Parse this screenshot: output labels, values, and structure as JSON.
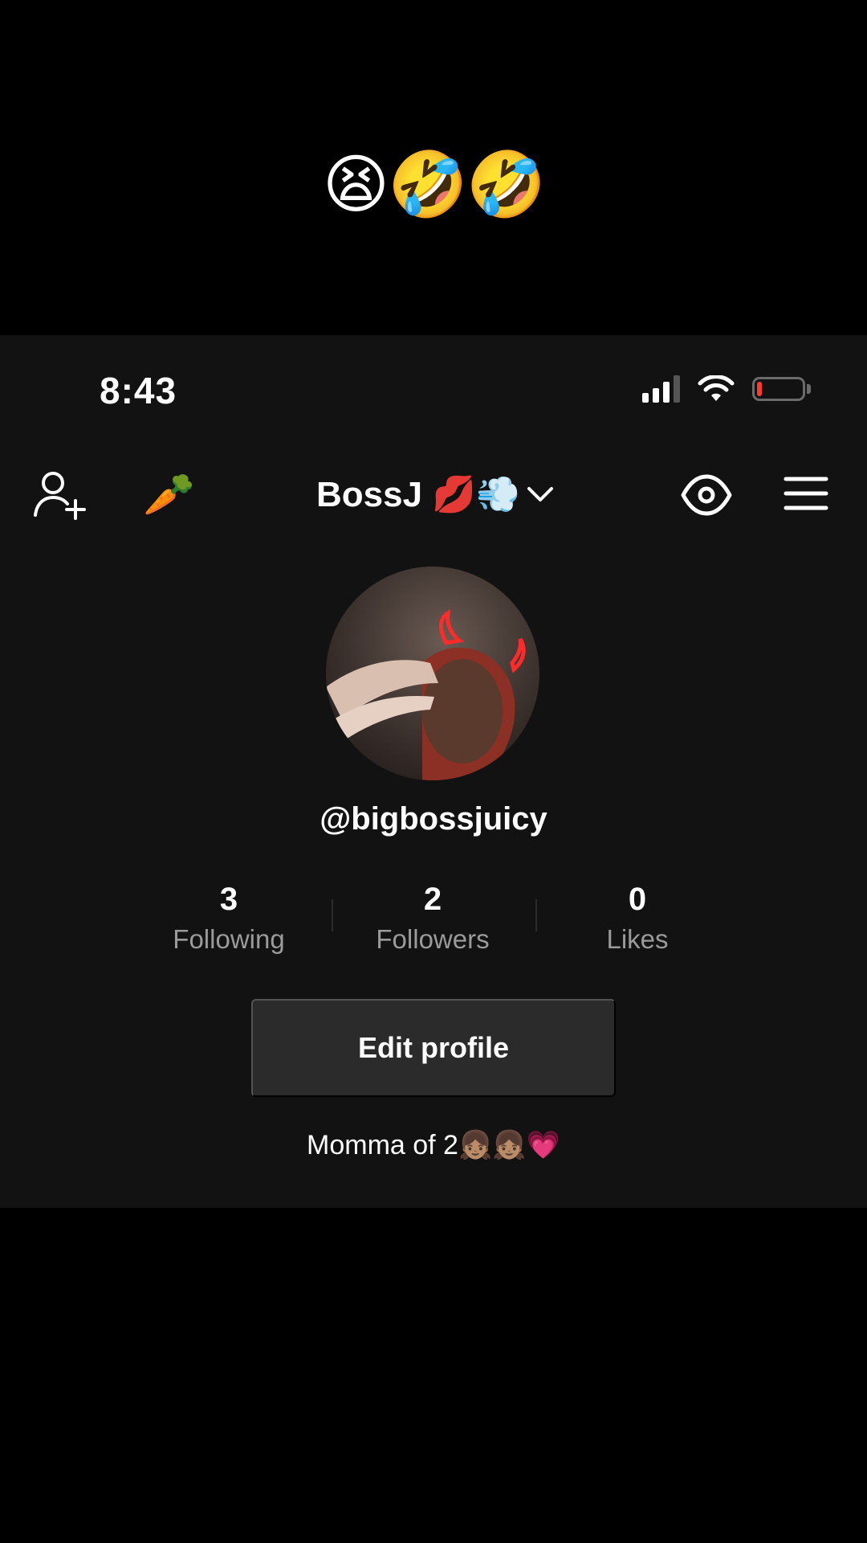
{
  "caption": "😫🤣🤣",
  "status_bar": {
    "time": "8:43",
    "battery_level": 0.12,
    "battery_color": "#ff3b30"
  },
  "nav": {
    "add_user_icon": "person-plus-icon",
    "carrot_emoji": "🥕",
    "account_name": "BossJ 💋💨",
    "dropdown_icon": "chevron-down-icon",
    "eye_icon": "eye-icon",
    "menu_icon": "hamburger-menu-icon"
  },
  "profile": {
    "username": "@bigbossjuicy",
    "stats": [
      {
        "value": "3",
        "label": "Following"
      },
      {
        "value": "2",
        "label": "Followers"
      },
      {
        "value": "0",
        "label": "Likes"
      }
    ],
    "edit_button": "Edit profile",
    "bio": "Momma of 2👧🏽👧🏽💗"
  },
  "colors": {
    "background": "#121212",
    "outer": "#000000",
    "button_bg": "#2b2b2b",
    "muted_text": "#9a9a9a"
  }
}
